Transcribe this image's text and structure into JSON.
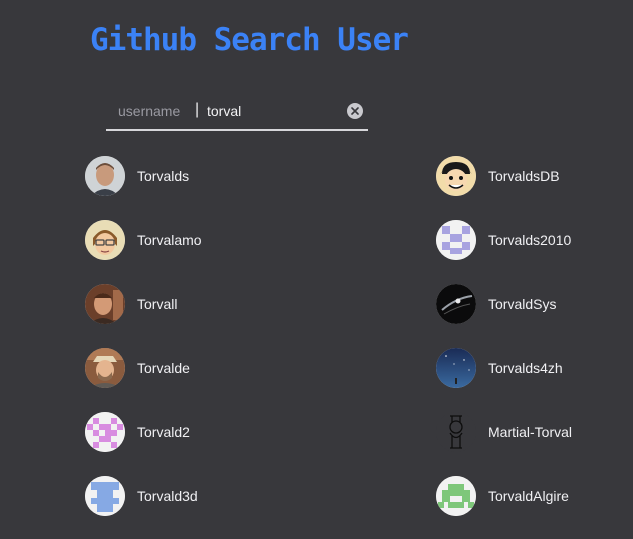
{
  "app": {
    "title": "Github Search User"
  },
  "search": {
    "prefix": "username",
    "separator": "|",
    "value": "torval",
    "clear_icon": "clear-icon"
  },
  "colors": {
    "background": "#38383c",
    "title": "#3b82f6",
    "text": "#f0f0f3"
  },
  "users": [
    {
      "login": "Torvalds",
      "avatar": "photo-portrait"
    },
    {
      "login": "TorvaldsDB",
      "avatar": "cartoon-face"
    },
    {
      "login": "Torvalamo",
      "avatar": "cartoon-glasses"
    },
    {
      "login": "Torvalds2010",
      "avatar": "identicon-lavender"
    },
    {
      "login": "Torvall",
      "avatar": "photo-portrait-warm"
    },
    {
      "login": "TorvaldSys",
      "avatar": "dark-space"
    },
    {
      "login": "Torvalde",
      "avatar": "photo-hat"
    },
    {
      "login": "Torvalds4zh",
      "avatar": "night-sky"
    },
    {
      "login": "Torvald2",
      "avatar": "identicon-pink"
    },
    {
      "login": "Martial-Torval",
      "avatar": "line-drawing"
    },
    {
      "login": "Torvald3d",
      "avatar": "identicon-blue"
    },
    {
      "login": "TorvaldAlgire",
      "avatar": "identicon-green"
    }
  ]
}
